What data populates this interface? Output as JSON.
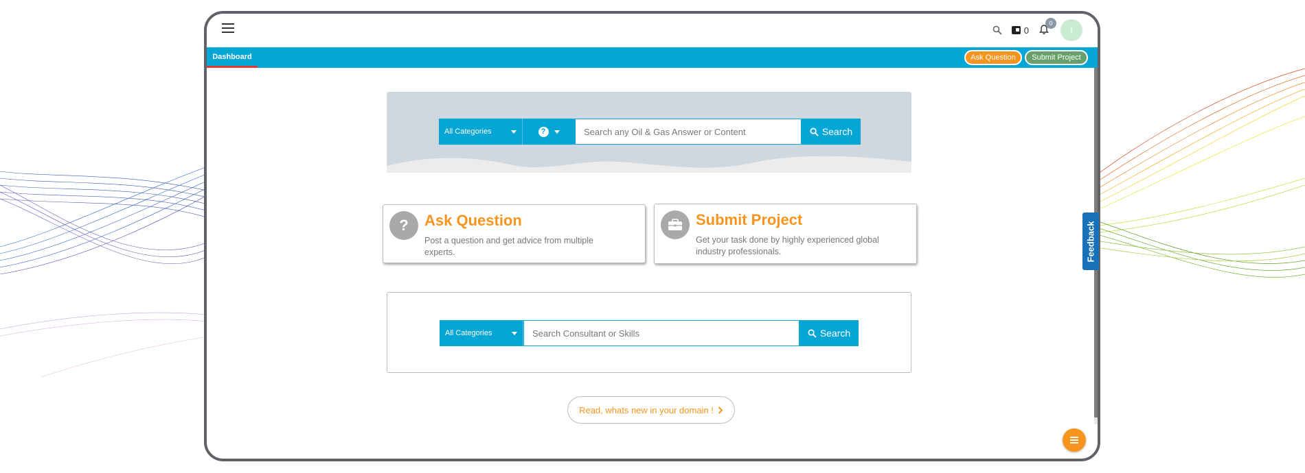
{
  "topbar": {
    "wallet_count": "0",
    "notification_count": "0",
    "avatar_initial": "I"
  },
  "nav": {
    "dashboard_tab": "Dashboard",
    "ask_question_btn": "Ask Question",
    "submit_project_btn": "Submit Project"
  },
  "hero_search": {
    "category": "All Categories",
    "placeholder": "Search any Oil & Gas Answer or Content",
    "search_btn": "Search"
  },
  "cards": {
    "ask": {
      "title": "Ask Question",
      "desc": "Post a question and get advice from multiple experts."
    },
    "submit": {
      "title": "Submit Project",
      "desc": "Get your task done by highly experienced global industry professionals."
    }
  },
  "consultant_search": {
    "category": "All Categories",
    "placeholder": "Search Consultant or Skills",
    "search_btn": "Search"
  },
  "readmore": "Read, whats new in your domain !",
  "feedback": "Feedback",
  "colors": {
    "primary": "#05a5d6",
    "accent": "#f7941d",
    "submit_green": "#67a06a",
    "feedback_blue": "#1770b8"
  }
}
